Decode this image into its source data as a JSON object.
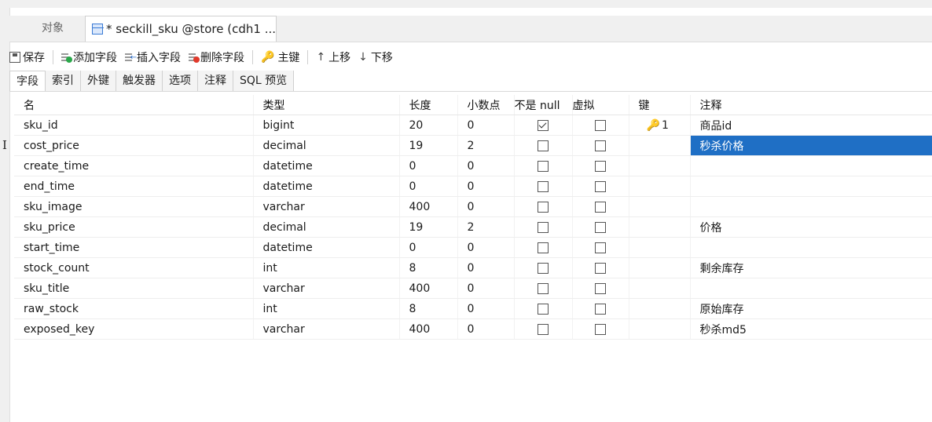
{
  "tabs": {
    "objects_label": "对象",
    "active_label": "* seckill_sku @store (cdh1 ..."
  },
  "toolbar": {
    "save": "保存",
    "add_field": "添加字段",
    "insert_field": "插入字段",
    "delete_field": "删除字段",
    "primary_key": "主键",
    "move_up": "上移",
    "move_down": "下移"
  },
  "subtabs": [
    "字段",
    "索引",
    "外键",
    "触发器",
    "选项",
    "注释",
    "SQL 预览"
  ],
  "columns": [
    "名",
    "类型",
    "长度",
    "小数点",
    "不是 null",
    "虚拟",
    "键",
    "注释"
  ],
  "rows": [
    {
      "name": "sku_id",
      "type": "bigint",
      "length": "20",
      "decimals": "0",
      "not_null": true,
      "virtual": false,
      "key": "1",
      "comment": "商品id"
    },
    {
      "name": "cost_price",
      "type": "decimal",
      "length": "19",
      "decimals": "2",
      "not_null": false,
      "virtual": false,
      "key": "",
      "comment": "秒杀价格"
    },
    {
      "name": "create_time",
      "type": "datetime",
      "length": "0",
      "decimals": "0",
      "not_null": false,
      "virtual": false,
      "key": "",
      "comment": ""
    },
    {
      "name": "end_time",
      "type": "datetime",
      "length": "0",
      "decimals": "0",
      "not_null": false,
      "virtual": false,
      "key": "",
      "comment": ""
    },
    {
      "name": "sku_image",
      "type": "varchar",
      "length": "400",
      "decimals": "0",
      "not_null": false,
      "virtual": false,
      "key": "",
      "comment": ""
    },
    {
      "name": "sku_price",
      "type": "decimal",
      "length": "19",
      "decimals": "2",
      "not_null": false,
      "virtual": false,
      "key": "",
      "comment": "价格"
    },
    {
      "name": "start_time",
      "type": "datetime",
      "length": "0",
      "decimals": "0",
      "not_null": false,
      "virtual": false,
      "key": "",
      "comment": ""
    },
    {
      "name": "stock_count",
      "type": "int",
      "length": "8",
      "decimals": "0",
      "not_null": false,
      "virtual": false,
      "key": "",
      "comment": "剩余库存"
    },
    {
      "name": "sku_title",
      "type": "varchar",
      "length": "400",
      "decimals": "0",
      "not_null": false,
      "virtual": false,
      "key": "",
      "comment": ""
    },
    {
      "name": "raw_stock",
      "type": "int",
      "length": "8",
      "decimals": "0",
      "not_null": false,
      "virtual": false,
      "key": "",
      "comment": "原始库存"
    },
    {
      "name": "exposed_key",
      "type": "varchar",
      "length": "400",
      "decimals": "0",
      "not_null": false,
      "virtual": false,
      "key": "",
      "comment": "秒杀md5"
    }
  ],
  "selected_comment_row": 1,
  "colors": {
    "selection": "#1f6fc5",
    "key_icon": "#e8a313"
  },
  "icons": [
    "table-icon",
    "save-icon",
    "add-field-icon",
    "insert-field-icon",
    "delete-field-icon",
    "key-icon",
    "arrow-up-icon",
    "arrow-down-icon"
  ]
}
